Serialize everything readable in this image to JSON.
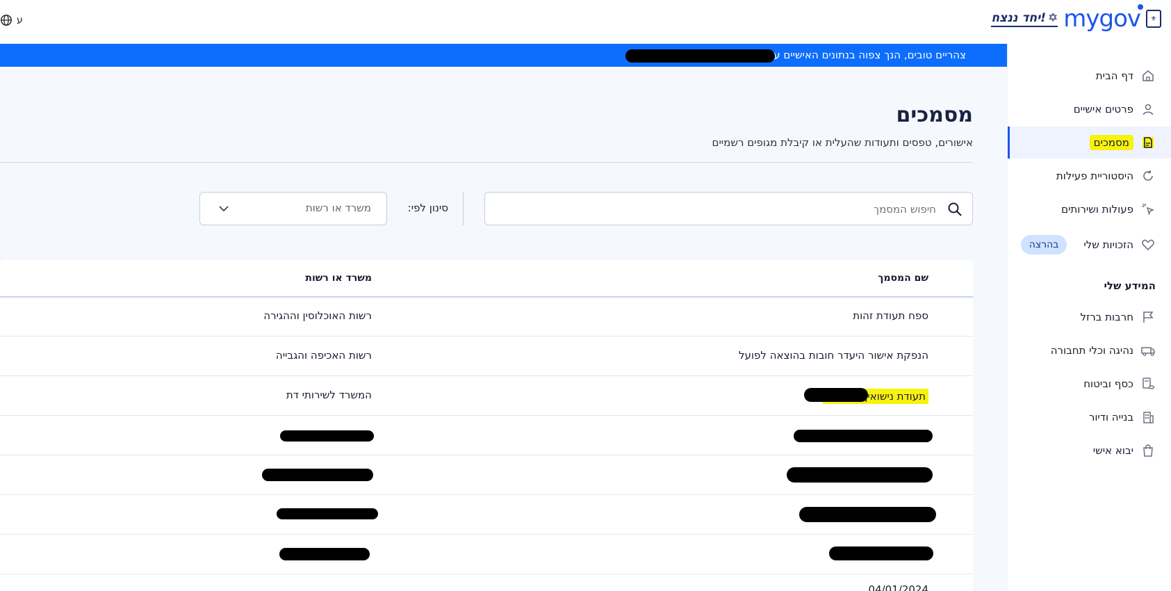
{
  "topbar": {
    "language_label": "ע",
    "brand_slogan": "יחד ננצח!",
    "brand_logo": "mygov"
  },
  "greeting": "צהריים טובים,  הנך צפוה בנתונים האישיים על",
  "sidebar": {
    "items": [
      {
        "label": "דף הבית",
        "icon": "home-icon"
      },
      {
        "label": "פרטים אישיים",
        "icon": "person-icon"
      },
      {
        "label": "מסמכים",
        "icon": "document-icon",
        "active": true
      },
      {
        "label": "היסטוריית פעילות",
        "icon": "history-icon"
      },
      {
        "label": "פעולות ושירותים",
        "icon": "click-icon"
      },
      {
        "label": "הזכויות שלי",
        "icon": "heart-icon",
        "badge": "בהרצה"
      }
    ],
    "section_title": "המידע שלי",
    "section_items": [
      {
        "label": "חרבות ברזל",
        "icon": "flag-icon"
      },
      {
        "label": "נהיגה וכלי תחבורה",
        "icon": "car-icon"
      },
      {
        "label": "כסף וביטוח",
        "icon": "money-icon"
      },
      {
        "label": "בנייה ודיור",
        "icon": "building-icon"
      },
      {
        "label": "יבוא אישי",
        "icon": "bag-icon"
      }
    ]
  },
  "main": {
    "title": "מסמכים",
    "subtitle": "אישורים, טפסים ותעודות שהעלית או קיבלת מגופים רשמיים",
    "search_placeholder": "חיפוש המסמך",
    "filter_label": "סינון לפי:",
    "filter_select_value": "משרד או רשות"
  },
  "table": {
    "headers": [
      "שם המסמך",
      "משרד או רשות"
    ],
    "rows": [
      {
        "doc": "ספח תעודת זהות",
        "office": "רשות האוכלוסין וההגירה"
      },
      {
        "doc": "הנפקת אישור היעדר חובות בהוצאה לפועל",
        "office": "רשות האכיפה והגבייה"
      },
      {
        "doc": "תעודת נישואין",
        "office": "המשרד לשירותי דת"
      },
      {
        "doc": "",
        "office": ""
      },
      {
        "doc": "",
        "office": ""
      },
      {
        "doc": "",
        "office": ""
      },
      {
        "doc": "",
        "office": ""
      }
    ],
    "partial_row_text": "04/01/2024"
  },
  "colors": {
    "accent": "#1a57e8",
    "strip": "#0d6efd",
    "highlight": "#f7f20e",
    "badge_bg": "#cfe2ff"
  }
}
